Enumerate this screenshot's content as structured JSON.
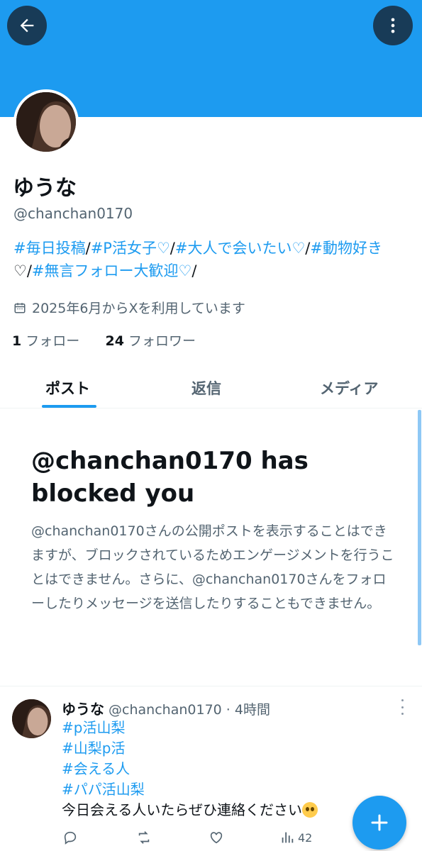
{
  "header": {
    "back_icon": "arrow-left-icon",
    "more_icon": "more-vertical-icon",
    "banner_color": "#1d9bf0"
  },
  "profile": {
    "name": "ゆうな",
    "handle": "@chanchan0170",
    "bio_segments": [
      {
        "text": "#毎日投稿",
        "type": "tag"
      },
      {
        "text": "/",
        "type": "plain"
      },
      {
        "text": "#P活女子♡",
        "type": "tag"
      },
      {
        "text": "/",
        "type": "plain"
      },
      {
        "text": "#大人で会いたい♡",
        "type": "tag"
      },
      {
        "text": "/",
        "type": "plain"
      },
      {
        "text": "#動物好き",
        "type": "tag"
      },
      {
        "text": "♡/",
        "type": "plain"
      },
      {
        "text": "#無言フォロー大歓迎♡",
        "type": "tag"
      },
      {
        "text": "/",
        "type": "plain"
      }
    ],
    "joined": "2025年6月からXを利用しています",
    "following_count": "1",
    "following_label": "フォロー",
    "followers_count": "24",
    "followers_label": "フォロワー"
  },
  "tabs": [
    {
      "label": "ポスト",
      "active": true
    },
    {
      "label": "返信",
      "active": false
    },
    {
      "label": "メディア",
      "active": false
    }
  ],
  "blocked": {
    "title": "@chanchan0170 has blocked you",
    "body": "@chanchan0170さんの公開ポストを表示することはできますが、ブロックされているためエンゲージメントを行うことはできません。さらに、@chanchan0170さんをフォローしたりメッセージを送信したりすることもできません。"
  },
  "post": {
    "author_name": "ゆうな",
    "author_handle": "@chanchan0170",
    "separator": "·",
    "time": "4時間",
    "hashtags": [
      "#p活山梨",
      "#山梨p活",
      "#会える人",
      "#パパ活山梨"
    ],
    "text": "今日会える人いたらぜひ連絡ください",
    "emoji": "pleading-face-emoji",
    "views": "42"
  },
  "fab": {
    "icon": "plus-icon"
  },
  "colors": {
    "accent": "#1d9bf0",
    "text": "#0f1419",
    "secondary": "#536471"
  }
}
